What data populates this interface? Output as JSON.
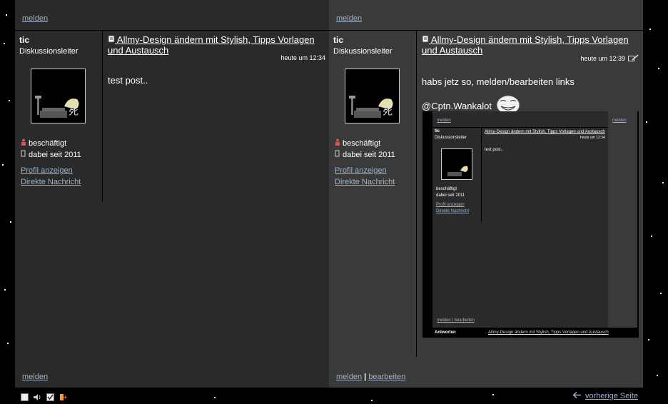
{
  "posts": [
    {
      "top_link": "melden",
      "user": "tic",
      "role": "Diskussionsleiter",
      "status": "beschäftigt",
      "member_since": "dabei seit 2011",
      "profile_link": "Profil anzeigen",
      "message_link": "Direkte Nachricht",
      "title": "Allmy-Design ändern mit Stylish, Tipps Vorlagen und Austausch",
      "time": "heute um 12:34",
      "text": "test post..",
      "bottom_link_1": "melden"
    },
    {
      "top_link": "melden",
      "user": "tic",
      "role": "Diskussionsleiter",
      "status": "beschäftigt",
      "member_since": "dabei seit 2011",
      "profile_link": "Profil anzeigen",
      "message_link": "Direkte Nachricht",
      "title": "Allmy-Design ändern mit Stylish, Tipps Vorlagen und Austausch",
      "time": "heute um 12:39",
      "text": "habs jetz so, melden/bearbeiten links",
      "mention": "@Cptn.Wankalot",
      "bottom_link_1": "melden",
      "bottom_sep": "|",
      "bottom_link_2": "bearbeiten"
    }
  ],
  "screenshot": {
    "top_left": "melden",
    "top_right": "melden",
    "user": "tic",
    "role": "Diskussionsleiter",
    "title": "Allmy-Design ändern mit Stylish, Tipps Vorlagen und Austausch",
    "time": "heute um 12:34",
    "text": "test post..",
    "status": "beschäftigt",
    "member_since": "dabei seit 2011",
    "profile_link": "Profil anzeigen",
    "message_link": "Direkte Nachricht",
    "bottom_links": "melden | bearbeiten",
    "reply": "Antworten",
    "footer_title": "Allmy-Design ändern mit Stylish, Tipps Vorlagen und Austausch"
  },
  "footer": {
    "prev_page": "vorherige Seite"
  }
}
